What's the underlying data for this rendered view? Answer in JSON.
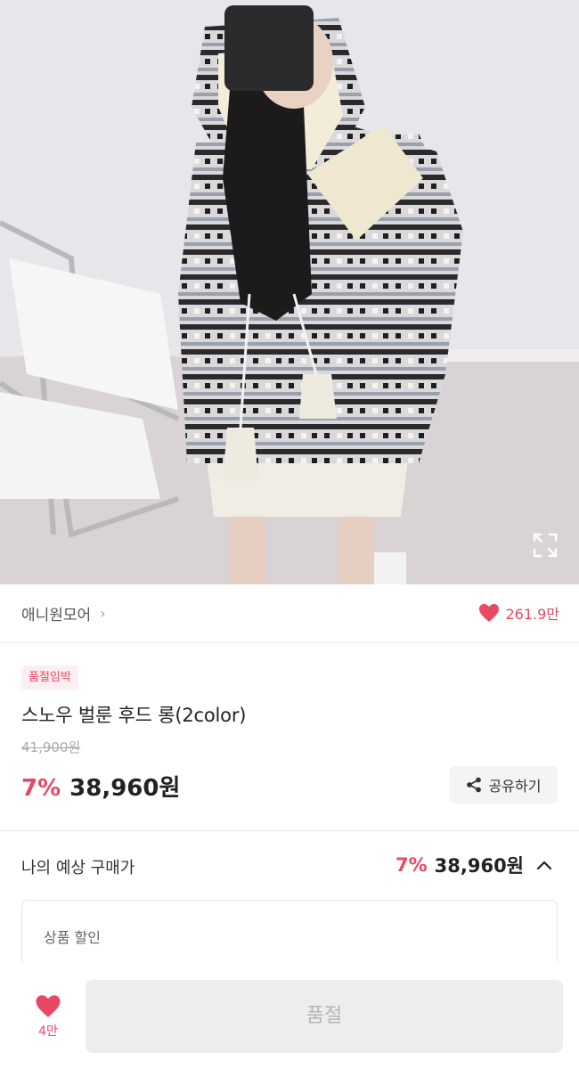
{
  "store": {
    "name": "애니원모어",
    "likes": "261.9만"
  },
  "product": {
    "badge": "품절임박",
    "title": "스노우 벌룬 후드 롱(2color)",
    "original_price": "41,900원",
    "discount_rate": "7%",
    "price": "38,960원"
  },
  "share": {
    "label": "공유하기"
  },
  "expected": {
    "label": "나의 예상 구매가",
    "discount_rate": "7%",
    "price": "38,960원"
  },
  "discount_section": {
    "label": "상품 할인"
  },
  "bottom": {
    "like_count": "4만",
    "buy_label": "품절"
  },
  "colors": {
    "accent": "#e94865",
    "disabled_bg": "#ededef",
    "disabled_text": "#b5b5b8"
  }
}
